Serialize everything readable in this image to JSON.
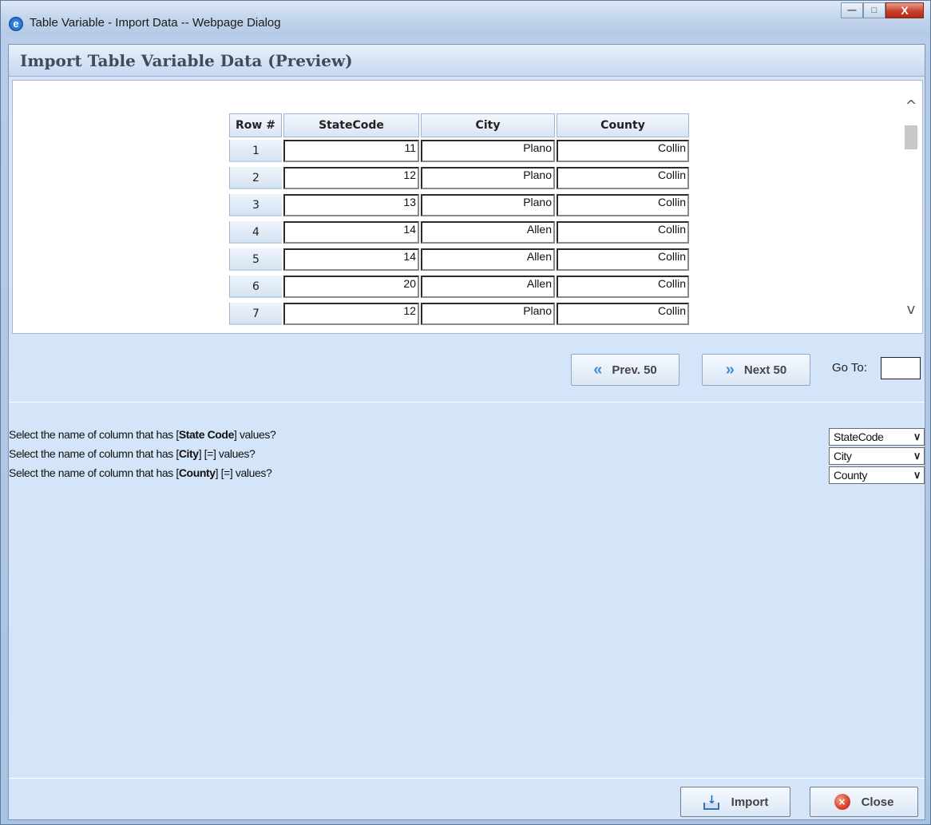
{
  "window": {
    "title": "Table Variable - Import Data -- Webpage Dialog",
    "ie_icon_glyph": "e",
    "minimize_glyph": "—",
    "maximize_glyph": "□",
    "close_glyph": "X"
  },
  "header": {
    "title": "Import Table Variable Data (Preview)"
  },
  "grid": {
    "columns": [
      "Row #",
      "StateCode",
      "City",
      "County"
    ],
    "rows": [
      {
        "row": "1",
        "state": "11",
        "city": "Plano",
        "county": "Collin"
      },
      {
        "row": "2",
        "state": "12",
        "city": "Plano",
        "county": "Collin"
      },
      {
        "row": "3",
        "state": "13",
        "city": "Plano",
        "county": "Collin"
      },
      {
        "row": "4",
        "state": "14",
        "city": "Allen",
        "county": "Collin"
      },
      {
        "row": "5",
        "state": "14",
        "city": "Allen",
        "county": "Collin"
      },
      {
        "row": "6",
        "state": "20",
        "city": "Allen",
        "county": "Collin"
      },
      {
        "row": "7",
        "state": "12",
        "city": "Plano",
        "county": "Collin"
      }
    ]
  },
  "scroll": {
    "up_glyph": "^",
    "down_glyph": "v"
  },
  "pager": {
    "prev_label": "Prev. 50",
    "next_label": "Next 50",
    "prev_glyph": "«",
    "next_glyph": "»",
    "goto_label": "Go To:",
    "goto_value": ""
  },
  "mapping": [
    {
      "prefix": "Select the name of column that has [",
      "field": "State Code",
      "suffix": "] values?",
      "selected": "StateCode"
    },
    {
      "prefix": "Select the name of column that has [",
      "field": "City",
      "suffix": "] [=] values?",
      "selected": "City"
    },
    {
      "prefix": "Select the name of column that has [",
      "field": "County",
      "suffix": "] [=] values?",
      "selected": "County"
    }
  ],
  "footer": {
    "import_label": "Import",
    "close_label": "Close",
    "close_icon_glyph": "×",
    "import_icon_glyph": "↓"
  },
  "colors": {
    "client_bg": "#d4e5f9",
    "header_text": "#3e4c5e",
    "accent_blue": "#3f8ad9",
    "close_red": "#d8402a"
  },
  "icons": [
    "ie-icon",
    "minimize-icon",
    "maximize-icon",
    "window-close-icon",
    "scroll-up-icon",
    "scroll-down-icon",
    "prev-chevron-icon",
    "next-chevron-icon",
    "dropdown-arrow-icon",
    "import-icon",
    "close-icon"
  ]
}
